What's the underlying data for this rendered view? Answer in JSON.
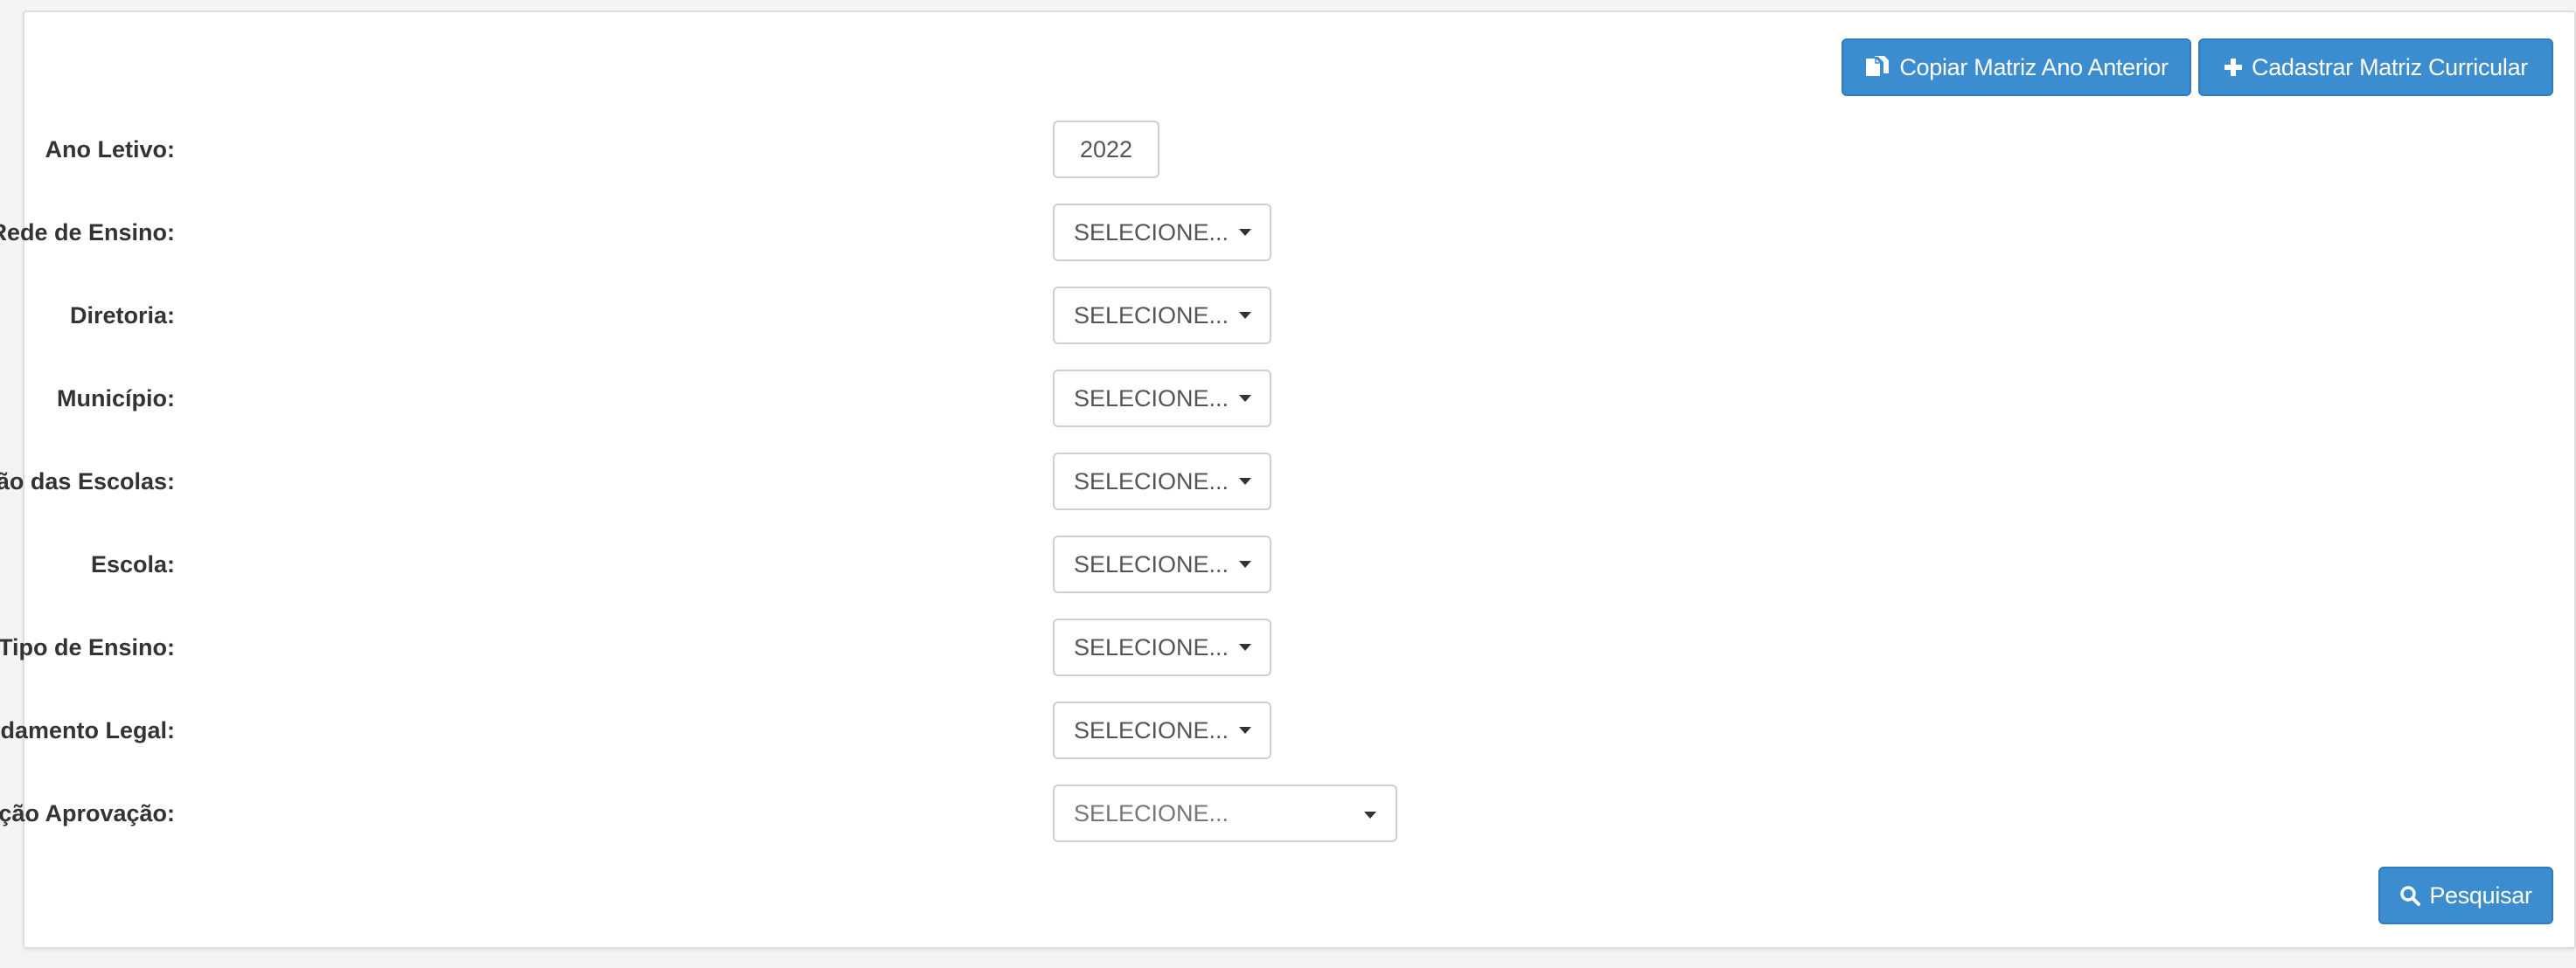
{
  "toolbar": {
    "copy_label": "Copiar Matriz Ano Anterior",
    "new_label": "Cadastrar Matriz Curricular"
  },
  "form": {
    "fields": [
      {
        "label": "Ano Letivo:",
        "value": "2022"
      },
      {
        "label": "Rede de Ensino:",
        "value": "SELECIONE..."
      },
      {
        "label": "Diretoria:",
        "value": "SELECIONE..."
      },
      {
        "label": "Município:",
        "value": "SELECIONE..."
      },
      {
        "label": "Situação das Escolas:",
        "value": "SELECIONE..."
      },
      {
        "label": "Escola:",
        "value": "SELECIONE..."
      },
      {
        "label": "Tipo de Ensino:",
        "value": "SELECIONE..."
      },
      {
        "label": "Fundamento Legal:",
        "value": "SELECIONE..."
      },
      {
        "label": "Situação Aprovação:",
        "value": "SELECIONE..."
      }
    ]
  },
  "actions": {
    "search_label": "Pesquisar"
  },
  "icons": {
    "copy": "copy-icon",
    "plus": "plus-icon",
    "search": "search-icon",
    "caret": "caret-down-icon"
  },
  "colors": {
    "primary": "#3c8dd0",
    "primary_border": "#2f7bbd",
    "label_text": "#333333",
    "input_border": "#cfcfcf"
  }
}
